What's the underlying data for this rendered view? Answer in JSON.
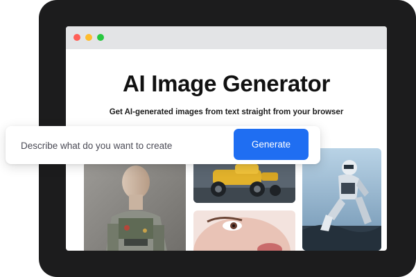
{
  "hero": {
    "title": "AI Image Generator",
    "subtitle": "Get AI-generated images from text straight from your browser"
  },
  "prompt": {
    "placeholder": "Describe what do you want to create",
    "button_label": "Generate"
  },
  "colors": {
    "frame": "#1c1c1d",
    "browser_bar": "#e3e4e6",
    "accent": "#1f6ef2",
    "traffic_red": "#ff5f57",
    "traffic_yellow": "#febc2e",
    "traffic_green": "#28c840"
  },
  "gallery": [
    {
      "name": "android-portrait-image"
    },
    {
      "name": "yellow-robot-vehicle-image"
    },
    {
      "name": "face-closeup-image"
    },
    {
      "name": "humanoid-robot-image"
    }
  ]
}
